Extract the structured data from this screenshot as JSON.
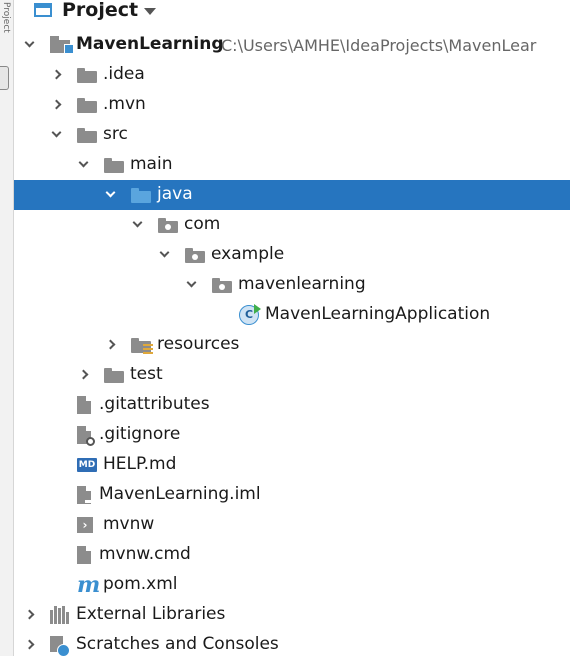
{
  "panel": {
    "title": "Project",
    "side_tab_label": "Project"
  },
  "tree": [
    {
      "label": "MavenLearning",
      "path": "C:\\Users\\AMHE\\IdeaProjects\\MavenLear",
      "depth": 0,
      "state": "expanded",
      "icon": "module-folder-icon",
      "bold": true
    },
    {
      "label": ".idea",
      "depth": 1,
      "state": "collapsed",
      "icon": "folder-icon"
    },
    {
      "label": ".mvn",
      "depth": 1,
      "state": "collapsed",
      "icon": "folder-icon"
    },
    {
      "label": "src",
      "depth": 1,
      "state": "expanded",
      "icon": "folder-icon"
    },
    {
      "label": "main",
      "depth": 2,
      "state": "expanded",
      "icon": "folder-icon"
    },
    {
      "label": "java",
      "depth": 3,
      "state": "expanded",
      "icon": "source-folder-icon",
      "selected": true
    },
    {
      "label": "com",
      "depth": 4,
      "state": "expanded",
      "icon": "package-icon"
    },
    {
      "label": "example",
      "depth": 5,
      "state": "expanded",
      "icon": "package-icon"
    },
    {
      "label": "mavenlearning",
      "depth": 6,
      "state": "expanded",
      "icon": "package-icon"
    },
    {
      "label": "MavenLearningApplication",
      "depth": 7,
      "state": "leaf",
      "icon": "spring-class-icon"
    },
    {
      "label": "resources",
      "depth": 3,
      "state": "collapsed",
      "icon": "resources-folder-icon"
    },
    {
      "label": "test",
      "depth": 2,
      "state": "collapsed",
      "icon": "folder-icon"
    },
    {
      "label": ".gitattributes",
      "depth": 1,
      "state": "leaf",
      "icon": "text-file-icon"
    },
    {
      "label": ".gitignore",
      "depth": 1,
      "state": "leaf",
      "icon": "ignore-file-icon"
    },
    {
      "label": "HELP.md",
      "depth": 1,
      "state": "leaf",
      "icon": "markdown-file-icon"
    },
    {
      "label": "MavenLearning.iml",
      "depth": 1,
      "state": "leaf",
      "icon": "iml-file-icon"
    },
    {
      "label": "mvnw",
      "depth": 1,
      "state": "leaf",
      "icon": "shell-script-icon"
    },
    {
      "label": "mvnw.cmd",
      "depth": 1,
      "state": "leaf",
      "icon": "text-file-icon"
    },
    {
      "label": "pom.xml",
      "depth": 1,
      "state": "leaf",
      "icon": "maven-icon"
    },
    {
      "label": "External Libraries",
      "depth": 0,
      "state": "collapsed",
      "icon": "library-icon"
    },
    {
      "label": "Scratches and Consoles",
      "depth": 0,
      "state": "collapsed",
      "icon": "scratches-icon"
    }
  ],
  "icon_text": {
    "md": "MD",
    "term": "›",
    "maven": "m",
    "class": "C"
  },
  "colors": {
    "selection": "#2675bf",
    "folder": "#8c8c8c",
    "source_folder": "#5aa5de",
    "accent": "#3a8fd0"
  }
}
